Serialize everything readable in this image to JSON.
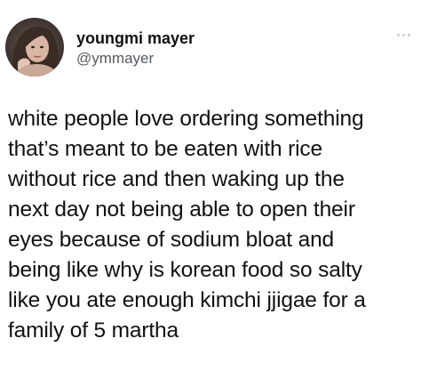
{
  "author": {
    "display_name": "youngmi mayer",
    "handle": "@ymmayer"
  },
  "icons": {
    "avatar": "profile-photo",
    "more": "more-horizontal-icon"
  },
  "colors": {
    "text": "#111111",
    "handle": "#555a60",
    "more_icon": "#c8cdd2",
    "background": "#ffffff"
  },
  "tweet": {
    "lines": [
      "white people love ordering something",
      "that’s meant to be eaten with rice",
      "without rice and then waking up the",
      "next day not being able to open their",
      "eyes because of sodium bloat and",
      "being like why is korean food so salty",
      "like you ate enough kimchi jjigae for a",
      "family of 5 martha"
    ]
  }
}
